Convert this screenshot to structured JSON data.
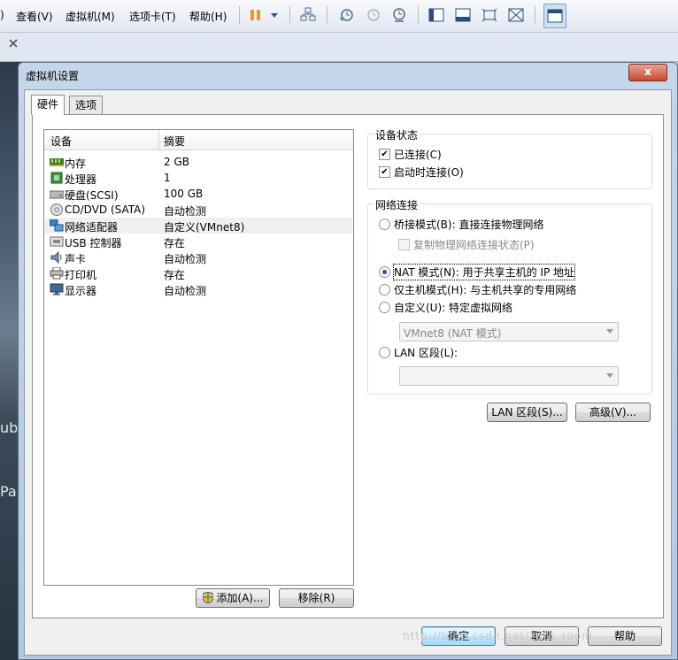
{
  "menubar": {
    "items": [
      "查看(V)",
      "虚拟机(M)",
      "选项卡(T)",
      "帮助(H)"
    ],
    "lead": ")"
  },
  "background": {
    "text1": "ubu",
    "text2": "Pa"
  },
  "dialog": {
    "title": "虚拟机设置",
    "close_label": "x",
    "tabs": [
      "硬件",
      "选项"
    ],
    "device_list": {
      "columns": [
        "设备",
        "摘要"
      ],
      "rows": [
        {
          "name": "内存",
          "summary": "2 GB",
          "icon": "memory-icon"
        },
        {
          "name": "处理器",
          "summary": "1",
          "icon": "processor-icon"
        },
        {
          "name": "硬盘(SCSI)",
          "summary": "100 GB",
          "icon": "hard-disk-icon"
        },
        {
          "name": "CD/DVD (SATA)",
          "summary": "自动检测",
          "icon": "cd-dvd-icon"
        },
        {
          "name": "网络适配器",
          "summary": "自定义(VMnet8)",
          "icon": "network-adapter-icon",
          "selected": true
        },
        {
          "name": "USB 控制器",
          "summary": "存在",
          "icon": "usb-icon"
        },
        {
          "name": "声卡",
          "summary": "自动检测",
          "icon": "sound-card-icon"
        },
        {
          "name": "打印机",
          "summary": "存在",
          "icon": "printer-icon"
        },
        {
          "name": "显示器",
          "summary": "自动检测",
          "icon": "display-icon"
        }
      ]
    },
    "add_button": "添加(A)...",
    "remove_button": "移除(R)",
    "device_status": {
      "title": "设备状态",
      "connected": "已连接(C)",
      "connect_at_power_on": "启动时连接(O)"
    },
    "network_connection": {
      "title": "网络连接",
      "bridged": "桥接模式(B): 直接连接物理网络",
      "replicate": "复制物理网络连接状态(P)",
      "nat": "NAT 模式(N): 用于共享主机的 IP 地址",
      "host_only": "仅主机模式(H): 与主机共享的专用网络",
      "custom": "自定义(U): 特定虚拟网络",
      "custom_value": "VMnet8 (NAT 模式)",
      "lan_segment": "LAN 区段(L):",
      "lan_value": ""
    },
    "lan_segments_button": "LAN 区段(S)...",
    "advanced_button": "高级(V)...",
    "ok_button": "确定",
    "cancel_button": "取消",
    "help_button": "帮助"
  },
  "watermark": "http://blog.csdn.net/zero_room"
}
